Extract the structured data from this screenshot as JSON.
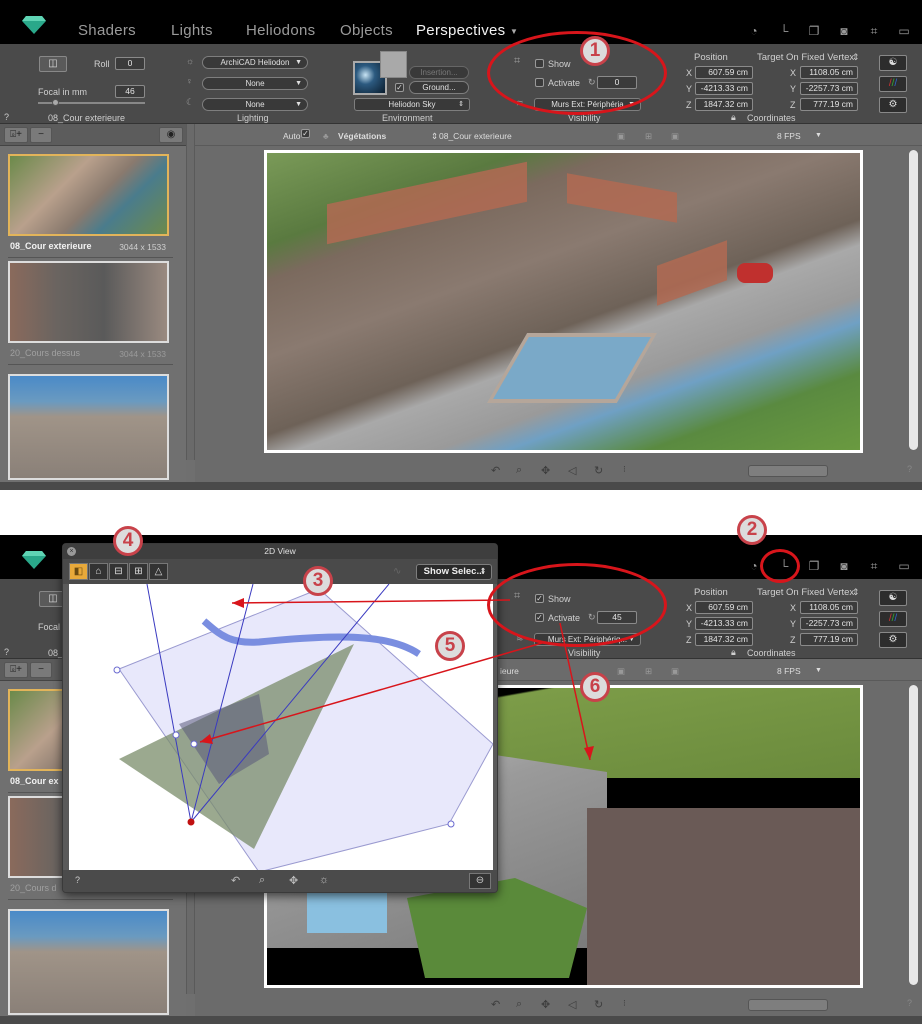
{
  "app": {
    "nav_tabs": [
      "Shaders",
      "Lights",
      "Heliodons",
      "Objects",
      "Perspectives"
    ],
    "active_tab": "Perspectives",
    "top_icons": [
      "timer-icon",
      "axis-icon",
      "windows-icon",
      "camera-icon",
      "crop-icon",
      "monitor-icon"
    ]
  },
  "screens": [
    {
      "camera": {
        "roll_label": "Roll",
        "roll_value": "0",
        "focal_label": "Focal in mm",
        "focal_value": "46",
        "name": "08_Cour exterieure",
        "help": "?"
      },
      "lighting": {
        "heliodon": "ArchiCAD Heliodon",
        "light": "None",
        "other": "None",
        "label": "Lighting"
      },
      "environment": {
        "insertion": "Insertion...",
        "ground": "Ground...",
        "ground_checked": true,
        "sky": "Heliodon Sky",
        "label": "Environment"
      },
      "visibility": {
        "show_label": "Show",
        "show_checked": false,
        "activate_label": "Activate",
        "activate_checked": false,
        "value": "0",
        "layer": "Murs Ext: Périphéria",
        "label": "Visibility"
      },
      "coordinates": {
        "position_label": "Position",
        "target_label": "Target On Fixed Vertex",
        "position": {
          "x": "607.59 cm",
          "y": "-4213.33 cm",
          "z": "1847.32 cm"
        },
        "target": {
          "x": "1108.05 cm",
          "y": "-2257.73 cm",
          "z": "777.19 cm"
        },
        "label": "Coordinates"
      },
      "viewbar": {
        "auto": "Auto",
        "vegetation": "Végétations",
        "perspective": "08_Cour exterieure",
        "fps": "8 FPS"
      },
      "thumbnails": [
        {
          "name": "08_Cour exterieure",
          "size": "3044 x 1533",
          "selected": true
        },
        {
          "name": "20_Cours dessus",
          "size": "3044 x 1533",
          "selected": false
        },
        {
          "name": "",
          "size": "",
          "selected": false
        }
      ],
      "badges": [
        "1"
      ]
    },
    {
      "camera": {
        "focal_label": "Focal",
        "name": "08_",
        "help": "?"
      },
      "visibility": {
        "show_label": "Show",
        "show_checked": true,
        "activate_label": "Activate",
        "activate_checked": true,
        "value": "45",
        "layer": "Murs Ext: Périphériq...",
        "label": "Visibility"
      },
      "coordinates": {
        "position_label": "Position",
        "target_label": "Target On Fixed Vertex",
        "position": {
          "x": "607.59 cm",
          "y": "-4213.33 cm",
          "z": "1847.32 cm"
        },
        "target": {
          "x": "1108.05 cm",
          "y": "-2257.73 cm",
          "z": "777.19 cm"
        },
        "label": "Coordinates"
      },
      "viewbar": {
        "perspective_tail": "ieure",
        "fps": "8 FPS"
      },
      "thumbnails": [
        {
          "name": "08_Cour ex",
          "selected": true
        },
        {
          "name": "20_Cours d",
          "selected": false
        },
        {
          "name": "",
          "selected": false
        }
      ],
      "dialog": {
        "title": "2D View",
        "show_select": "Show Selec...",
        "help": "?"
      },
      "badges": [
        "2",
        "3",
        "4",
        "5",
        "6"
      ]
    }
  ],
  "axis_labels": {
    "x": "X",
    "y": "Y",
    "z": "Z"
  },
  "help": "?"
}
